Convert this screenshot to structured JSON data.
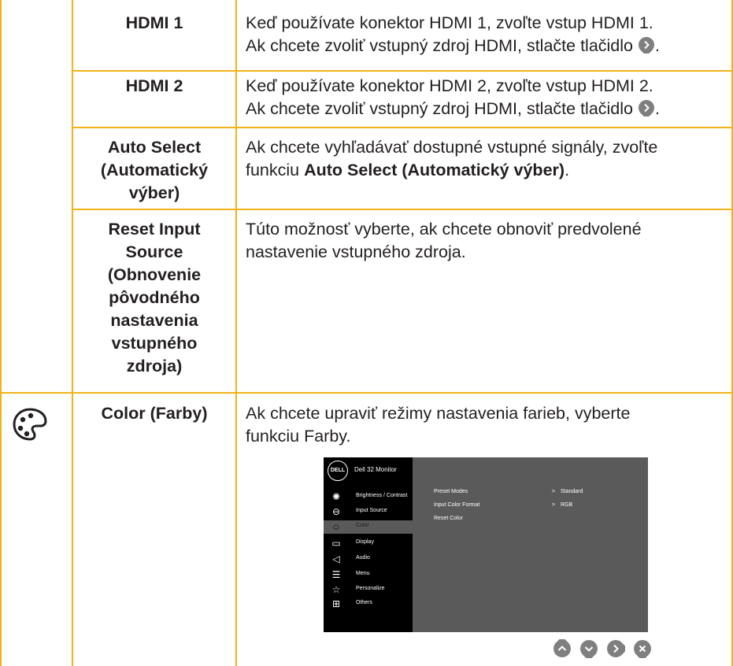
{
  "rows": [
    {
      "name": "HDMI 1",
      "desc_line1": "Keď používate konektor HDMI 1, zvoľte vstup HDMI 1.",
      "desc_line2": "Ak chcete zvoliť vstupný zdroj HDMI, stlačte tlačidlo",
      "desc_end": "."
    },
    {
      "name": "HDMI 2",
      "desc_line1": "Keď používate konektor HDMI 2, zvoľte vstup HDMI 2.",
      "desc_line2": "Ak chcete zvoliť vstupný zdroj HDMI, stlačte tlačidlo",
      "desc_end": "."
    },
    {
      "name_lines": [
        "Auto Select",
        "(Automatický",
        "výber)"
      ],
      "desc_line1": "Ak chcete vyhľadávať dostupné vstupné signály, zvoľte",
      "desc_line2_pre": "funkciu ",
      "desc_line2_bold": "Auto Select (Automatický výber)",
      "desc_line2_end": "."
    },
    {
      "name_lines": [
        "Reset Input",
        "Source",
        "(Obnovenie",
        "pôvodného",
        "nastavenia",
        "vstupného",
        "zdroja)"
      ],
      "desc_line1": "Túto možnosť vyberte, ak chcete obnoviť predvolené",
      "desc_line2": "nastavenie vstupného zdroja."
    },
    {
      "name": "Color (Farby)",
      "icon": "palette-icon",
      "desc_line1": "Ak chcete upraviť režimy nastavenia farieb, vyberte",
      "desc_line2": "funkciu Farby."
    }
  ],
  "osd": {
    "logo": "DELL",
    "title": "Dell 32 Monitor",
    "menu": [
      {
        "label": "Brightness / Contrast",
        "icon": "brightness-icon"
      },
      {
        "label": "Input Source",
        "icon": "input-source-icon"
      },
      {
        "label": "Color",
        "icon": "color-palette-icon",
        "selected": true
      },
      {
        "label": "Display",
        "icon": "display-icon"
      },
      {
        "label": "Audio",
        "icon": "audio-icon"
      },
      {
        "label": "Menu",
        "icon": "menu-icon"
      },
      {
        "label": "Personalize",
        "icon": "star-icon"
      },
      {
        "label": "Others",
        "icon": "others-icon"
      }
    ],
    "settings": [
      {
        "label": "Preset Modes",
        "value": "Standard"
      },
      {
        "label": "Input Color Format",
        "value": "RGB"
      },
      {
        "label": "Reset Color",
        "value": ""
      }
    ],
    "arrow": ">"
  },
  "nav_buttons": [
    "up-button-icon",
    "down-button-icon",
    "right-button-icon",
    "close-button-icon"
  ],
  "colors": {
    "border": "#f2b318",
    "button": "#7f7f7f",
    "osd_bg": "#000000",
    "osd_panel": "#5a5a5a"
  }
}
